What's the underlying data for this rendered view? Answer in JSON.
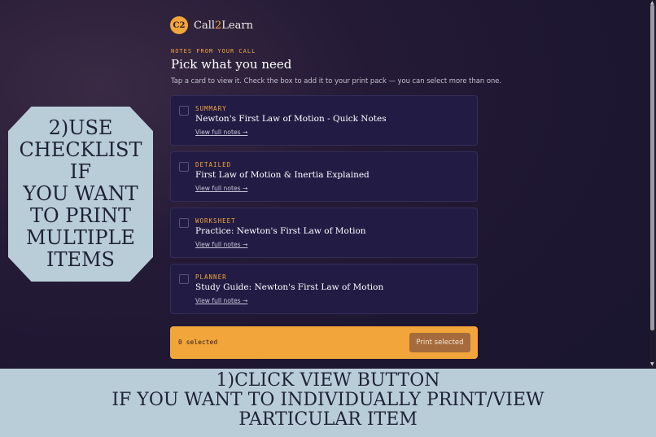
{
  "app": {
    "logo_badge": "C2",
    "name_part1": "Call",
    "name_accent": "2",
    "name_part2": "Learn"
  },
  "header": {
    "eyebrow": "NOTES FROM YOUR CALL",
    "title": "Pick what you need",
    "subtitle": "Tap a card to view it. Check the box to add it to your print pack — you can select more than one."
  },
  "cards": [
    {
      "tag": "SUMMARY",
      "title": "Newton's First Law of Motion - Quick Notes",
      "link": "View full notes →",
      "checked": false
    },
    {
      "tag": "DETAILED",
      "title": "First Law of Motion & Inertia Explained",
      "link": "View full notes →",
      "checked": false
    },
    {
      "tag": "WORKSHEET",
      "title": "Practice: Newton's First Law of Motion",
      "link": "View full notes →",
      "checked": false
    },
    {
      "tag": "PLANNER",
      "title": "Study Guide: Newton's First Law of Motion",
      "link": "View full notes →",
      "checked": false
    }
  ],
  "print_bar": {
    "count_text": "0 selected",
    "button_label": "Print selected"
  },
  "overlay_left": {
    "lines": [
      "2)USE",
      "CHECKLIST",
      "IF",
      "YOU WANT",
      "TO PRINT",
      "MULTIPLE",
      "ITEMS"
    ]
  },
  "overlay_bottom": {
    "lines": [
      "1)CLICK VIEW BUTTON",
      "IF YOU WANT TO INDIVIDUALLY PRINT/VIEW",
      "PARTICULAR ITEM"
    ]
  },
  "colors": {
    "accent": "#f2a53a",
    "card_bg": "#221c44",
    "overlay_bg": "#b9cdd8"
  }
}
